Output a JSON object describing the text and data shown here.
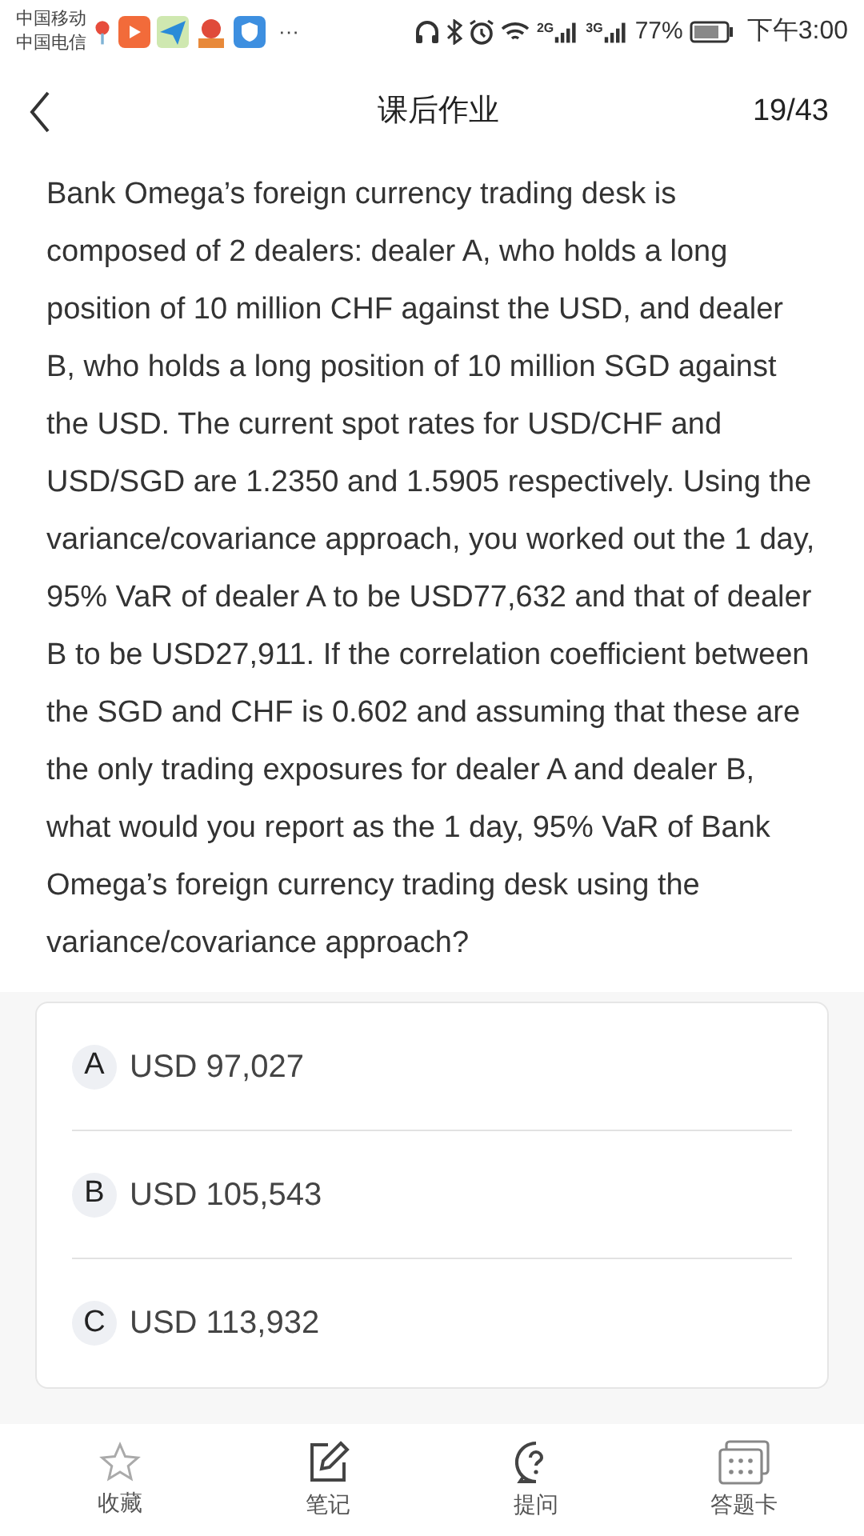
{
  "status_bar": {
    "carriers": [
      "中国移动",
      "中国电信"
    ],
    "more": "···",
    "network_1": "2G",
    "network_2": "3G",
    "battery": "77%",
    "time": "下午3:00"
  },
  "header": {
    "title": "课后作业",
    "progress": "19/43"
  },
  "question": "Bank Omega’s foreign currency trading desk is composed of 2 dealers: dealer A, who holds a long position of 10 million CHF against the USD, and dealer B, who holds a long position of 10 million SGD against the USD. The current spot rates for USD/CHF and USD/SGD are 1.2350 and 1.5905 respectively. Using the variance/covariance approach, you worked out the 1 day, 95% VaR of dealer A to be USD77,632 and that of dealer B to be USD27,911. If the correlation coefficient between the SGD and CHF is 0.602 and assuming that these are the only trading exposures for dealer A and dealer B, what would you report as the 1 day, 95% VaR of Bank Omega’s foreign currency trading desk using the variance/covariance approach?",
  "options": [
    {
      "letter": "A",
      "text": "USD 97,027"
    },
    {
      "letter": "B",
      "text": "USD 105,543"
    },
    {
      "letter": "C",
      "text": "USD 113,932"
    }
  ],
  "bottom_nav": [
    {
      "kind": "star",
      "label": "收藏"
    },
    {
      "kind": "note",
      "label": "笔记"
    },
    {
      "kind": "question",
      "label": "提问"
    },
    {
      "kind": "card",
      "label": "答题卡"
    }
  ]
}
